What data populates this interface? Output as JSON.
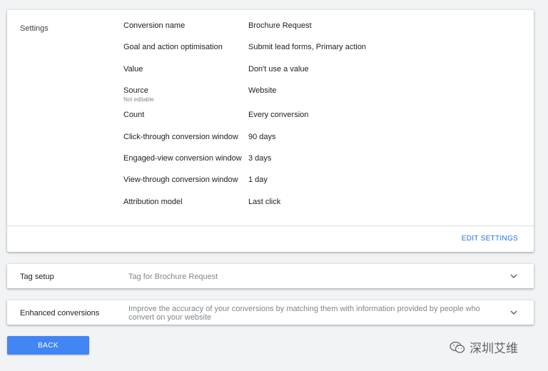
{
  "settings": {
    "title": "Settings",
    "rows": [
      {
        "label": "Conversion name",
        "value": "Brochure Request"
      },
      {
        "label": "Goal and action optimisation",
        "value": "Submit lead forms, Primary action"
      },
      {
        "label": "Value",
        "value": "Don't use a value"
      },
      {
        "label": "Source",
        "sub": "Not editable",
        "value": "Website"
      },
      {
        "label": "Count",
        "value": "Every conversion"
      },
      {
        "label": "Click-through conversion window",
        "value": "90 days"
      },
      {
        "label": "Engaged-view conversion window",
        "value": "3 days"
      },
      {
        "label": "View-through conversion window",
        "value": "1 day"
      },
      {
        "label": "Attribution model",
        "value": "Last click"
      }
    ],
    "edit_label": "EDIT SETTINGS"
  },
  "tag_setup": {
    "title": "Tag setup",
    "description": "Tag for Brochure Request",
    "icon": "chevron-down-icon"
  },
  "enhanced_conversions": {
    "title": "Enhanced conversions",
    "description": "Improve the accuracy of your conversions by matching them with information provided by people who convert on your website",
    "icon": "chevron-down-icon"
  },
  "back_label": "BACK",
  "watermark": {
    "text": "深圳艾维",
    "icon": "wechat-icon"
  },
  "colors": {
    "accent": "#1a73e8",
    "button": "#4285f4",
    "background": "#f1f3f4"
  }
}
